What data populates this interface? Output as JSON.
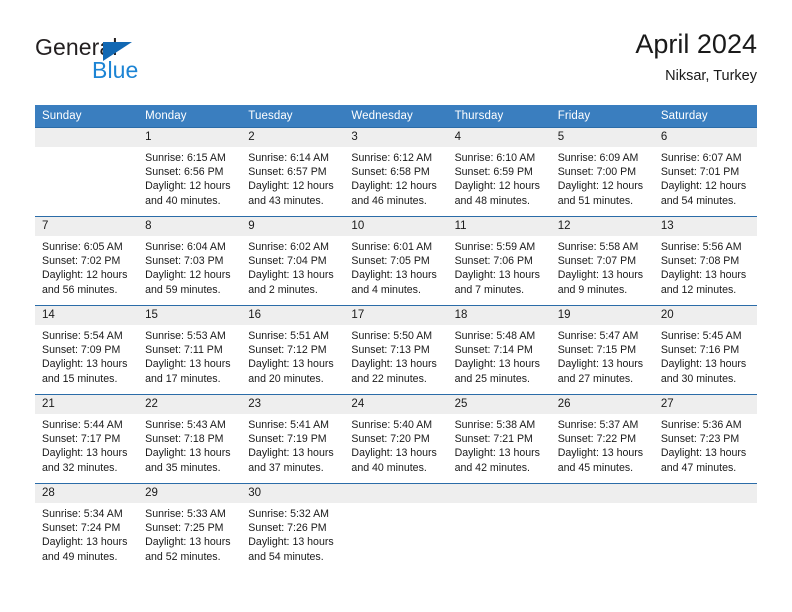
{
  "brand": {
    "name_part1": "General",
    "name_part2": "Blue",
    "triangle_color": "#1268b3",
    "blue_text_color": "#1c84d4"
  },
  "header": {
    "title": "April 2024",
    "subtitle": "Niksar, Turkey",
    "header_bg_color": "#3a7ebf",
    "row_divider_color": "#2b6ca8",
    "daynum_bg_color": "#eeeeee"
  },
  "weekday_headers": [
    "Sunday",
    "Monday",
    "Tuesday",
    "Wednesday",
    "Thursday",
    "Friday",
    "Saturday"
  ],
  "weeks": [
    [
      {
        "day": "",
        "sunrise": "",
        "sunset": "",
        "daylight_line1": "",
        "daylight_line2": ""
      },
      {
        "day": "1",
        "sunrise": "Sunrise: 6:15 AM",
        "sunset": "Sunset: 6:56 PM",
        "daylight_line1": "Daylight: 12 hours",
        "daylight_line2": "and 40 minutes."
      },
      {
        "day": "2",
        "sunrise": "Sunrise: 6:14 AM",
        "sunset": "Sunset: 6:57 PM",
        "daylight_line1": "Daylight: 12 hours",
        "daylight_line2": "and 43 minutes."
      },
      {
        "day": "3",
        "sunrise": "Sunrise: 6:12 AM",
        "sunset": "Sunset: 6:58 PM",
        "daylight_line1": "Daylight: 12 hours",
        "daylight_line2": "and 46 minutes."
      },
      {
        "day": "4",
        "sunrise": "Sunrise: 6:10 AM",
        "sunset": "Sunset: 6:59 PM",
        "daylight_line1": "Daylight: 12 hours",
        "daylight_line2": "and 48 minutes."
      },
      {
        "day": "5",
        "sunrise": "Sunrise: 6:09 AM",
        "sunset": "Sunset: 7:00 PM",
        "daylight_line1": "Daylight: 12 hours",
        "daylight_line2": "and 51 minutes."
      },
      {
        "day": "6",
        "sunrise": "Sunrise: 6:07 AM",
        "sunset": "Sunset: 7:01 PM",
        "daylight_line1": "Daylight: 12 hours",
        "daylight_line2": "and 54 minutes."
      }
    ],
    [
      {
        "day": "7",
        "sunrise": "Sunrise: 6:05 AM",
        "sunset": "Sunset: 7:02 PM",
        "daylight_line1": "Daylight: 12 hours",
        "daylight_line2": "and 56 minutes."
      },
      {
        "day": "8",
        "sunrise": "Sunrise: 6:04 AM",
        "sunset": "Sunset: 7:03 PM",
        "daylight_line1": "Daylight: 12 hours",
        "daylight_line2": "and 59 minutes."
      },
      {
        "day": "9",
        "sunrise": "Sunrise: 6:02 AM",
        "sunset": "Sunset: 7:04 PM",
        "daylight_line1": "Daylight: 13 hours",
        "daylight_line2": "and 2 minutes."
      },
      {
        "day": "10",
        "sunrise": "Sunrise: 6:01 AM",
        "sunset": "Sunset: 7:05 PM",
        "daylight_line1": "Daylight: 13 hours",
        "daylight_line2": "and 4 minutes."
      },
      {
        "day": "11",
        "sunrise": "Sunrise: 5:59 AM",
        "sunset": "Sunset: 7:06 PM",
        "daylight_line1": "Daylight: 13 hours",
        "daylight_line2": "and 7 minutes."
      },
      {
        "day": "12",
        "sunrise": "Sunrise: 5:58 AM",
        "sunset": "Sunset: 7:07 PM",
        "daylight_line1": "Daylight: 13 hours",
        "daylight_line2": "and 9 minutes."
      },
      {
        "day": "13",
        "sunrise": "Sunrise: 5:56 AM",
        "sunset": "Sunset: 7:08 PM",
        "daylight_line1": "Daylight: 13 hours",
        "daylight_line2": "and 12 minutes."
      }
    ],
    [
      {
        "day": "14",
        "sunrise": "Sunrise: 5:54 AM",
        "sunset": "Sunset: 7:09 PM",
        "daylight_line1": "Daylight: 13 hours",
        "daylight_line2": "and 15 minutes."
      },
      {
        "day": "15",
        "sunrise": "Sunrise: 5:53 AM",
        "sunset": "Sunset: 7:11 PM",
        "daylight_line1": "Daylight: 13 hours",
        "daylight_line2": "and 17 minutes."
      },
      {
        "day": "16",
        "sunrise": "Sunrise: 5:51 AM",
        "sunset": "Sunset: 7:12 PM",
        "daylight_line1": "Daylight: 13 hours",
        "daylight_line2": "and 20 minutes."
      },
      {
        "day": "17",
        "sunrise": "Sunrise: 5:50 AM",
        "sunset": "Sunset: 7:13 PM",
        "daylight_line1": "Daylight: 13 hours",
        "daylight_line2": "and 22 minutes."
      },
      {
        "day": "18",
        "sunrise": "Sunrise: 5:48 AM",
        "sunset": "Sunset: 7:14 PM",
        "daylight_line1": "Daylight: 13 hours",
        "daylight_line2": "and 25 minutes."
      },
      {
        "day": "19",
        "sunrise": "Sunrise: 5:47 AM",
        "sunset": "Sunset: 7:15 PM",
        "daylight_line1": "Daylight: 13 hours",
        "daylight_line2": "and 27 minutes."
      },
      {
        "day": "20",
        "sunrise": "Sunrise: 5:45 AM",
        "sunset": "Sunset: 7:16 PM",
        "daylight_line1": "Daylight: 13 hours",
        "daylight_line2": "and 30 minutes."
      }
    ],
    [
      {
        "day": "21",
        "sunrise": "Sunrise: 5:44 AM",
        "sunset": "Sunset: 7:17 PM",
        "daylight_line1": "Daylight: 13 hours",
        "daylight_line2": "and 32 minutes."
      },
      {
        "day": "22",
        "sunrise": "Sunrise: 5:43 AM",
        "sunset": "Sunset: 7:18 PM",
        "daylight_line1": "Daylight: 13 hours",
        "daylight_line2": "and 35 minutes."
      },
      {
        "day": "23",
        "sunrise": "Sunrise: 5:41 AM",
        "sunset": "Sunset: 7:19 PM",
        "daylight_line1": "Daylight: 13 hours",
        "daylight_line2": "and 37 minutes."
      },
      {
        "day": "24",
        "sunrise": "Sunrise: 5:40 AM",
        "sunset": "Sunset: 7:20 PM",
        "daylight_line1": "Daylight: 13 hours",
        "daylight_line2": "and 40 minutes."
      },
      {
        "day": "25",
        "sunrise": "Sunrise: 5:38 AM",
        "sunset": "Sunset: 7:21 PM",
        "daylight_line1": "Daylight: 13 hours",
        "daylight_line2": "and 42 minutes."
      },
      {
        "day": "26",
        "sunrise": "Sunrise: 5:37 AM",
        "sunset": "Sunset: 7:22 PM",
        "daylight_line1": "Daylight: 13 hours",
        "daylight_line2": "and 45 minutes."
      },
      {
        "day": "27",
        "sunrise": "Sunrise: 5:36 AM",
        "sunset": "Sunset: 7:23 PM",
        "daylight_line1": "Daylight: 13 hours",
        "daylight_line2": "and 47 minutes."
      }
    ],
    [
      {
        "day": "28",
        "sunrise": "Sunrise: 5:34 AM",
        "sunset": "Sunset: 7:24 PM",
        "daylight_line1": "Daylight: 13 hours",
        "daylight_line2": "and 49 minutes."
      },
      {
        "day": "29",
        "sunrise": "Sunrise: 5:33 AM",
        "sunset": "Sunset: 7:25 PM",
        "daylight_line1": "Daylight: 13 hours",
        "daylight_line2": "and 52 minutes."
      },
      {
        "day": "30",
        "sunrise": "Sunrise: 5:32 AM",
        "sunset": "Sunset: 7:26 PM",
        "daylight_line1": "Daylight: 13 hours",
        "daylight_line2": "and 54 minutes."
      },
      {
        "day": "",
        "sunrise": "",
        "sunset": "",
        "daylight_line1": "",
        "daylight_line2": ""
      },
      {
        "day": "",
        "sunrise": "",
        "sunset": "",
        "daylight_line1": "",
        "daylight_line2": ""
      },
      {
        "day": "",
        "sunrise": "",
        "sunset": "",
        "daylight_line1": "",
        "daylight_line2": ""
      },
      {
        "day": "",
        "sunrise": "",
        "sunset": "",
        "daylight_line1": "",
        "daylight_line2": ""
      }
    ]
  ]
}
